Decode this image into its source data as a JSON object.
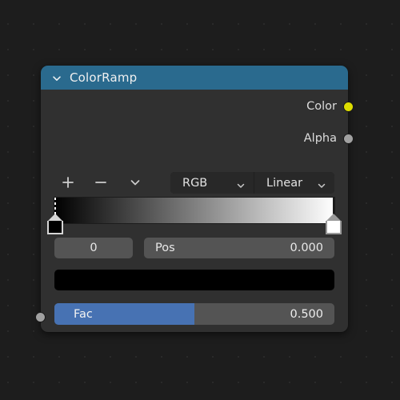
{
  "node": {
    "title": "ColorRamp",
    "header_color": "#2a6a8e",
    "body_color": "#303030",
    "collapse_icon": "chevron-down-icon",
    "outputs": [
      {
        "label": "Color",
        "socket_color": "#dcdc00",
        "socket_icon": "color-socket"
      },
      {
        "label": "Alpha",
        "socket_color": "#a1a1a1",
        "socket_icon": "alpha-socket"
      }
    ],
    "toolbar": {
      "add_icon": "plus-icon",
      "remove_icon": "minus-icon",
      "menu_icon": "chevron-down-icon",
      "color_mode": {
        "value": "RGB",
        "chevron": "chevron-down-icon"
      },
      "interpolation": {
        "value": "Linear",
        "chevron": "chevron-down-icon"
      }
    },
    "ramp": {
      "start_color": "#000000",
      "end_color": "#ffffff",
      "stops": [
        {
          "position": 0.0,
          "color": "#000000",
          "selected": true
        },
        {
          "position": 1.0,
          "color": "#ffffff",
          "selected": false
        }
      ]
    },
    "active_stop": {
      "index": "0",
      "pos_label": "Pos",
      "pos_value": "0.000",
      "color_value": "#000000"
    },
    "inputs": [
      {
        "label": "Fac",
        "value": "0.500",
        "fill_fraction": 0.5,
        "fill_color": "#4772b3",
        "socket_color": "#a1a1a1",
        "socket_icon": "value-socket"
      }
    ]
  }
}
